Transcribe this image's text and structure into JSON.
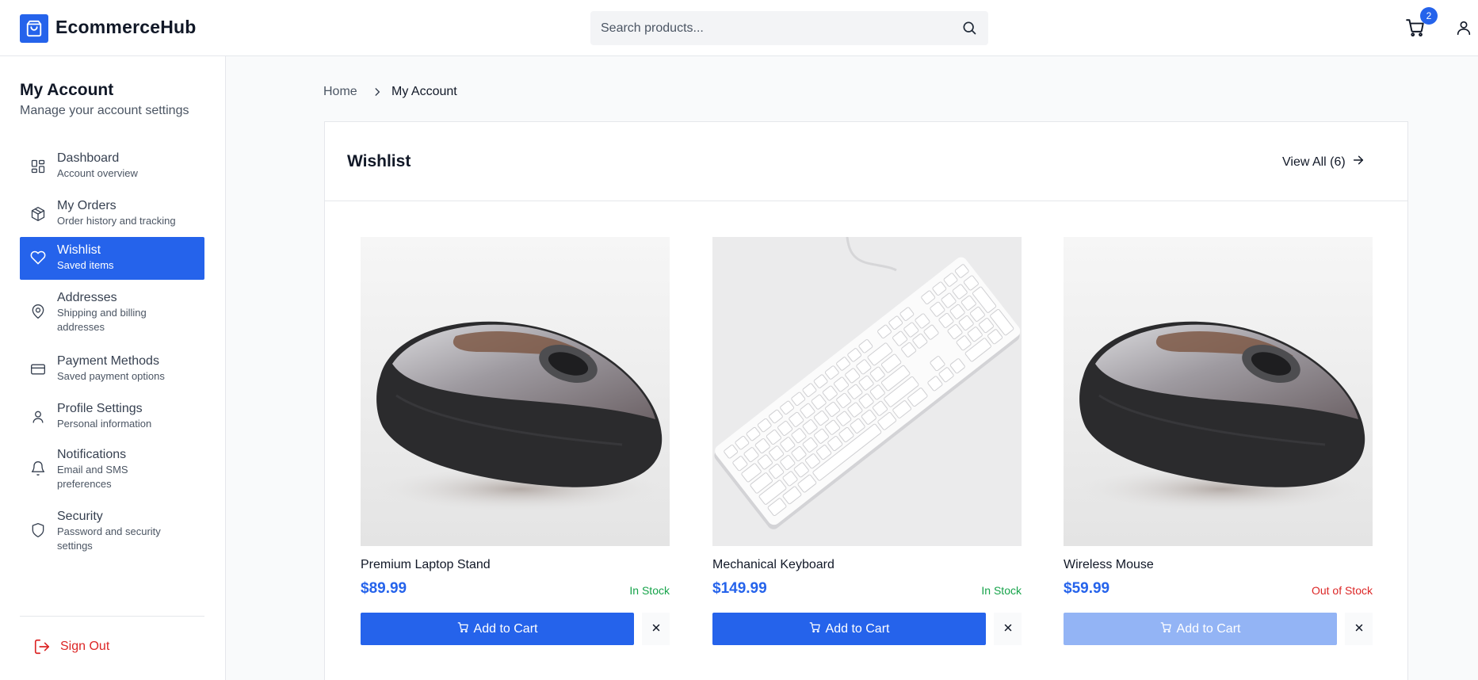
{
  "header": {
    "brand": "EcommerceHub",
    "search_placeholder": "Search products...",
    "cart_count": "2"
  },
  "sidebar": {
    "title": "My Account",
    "subtitle": "Manage your account settings",
    "items": [
      {
        "label": "Dashboard",
        "desc": "Account overview",
        "icon": "dashboard-icon"
      },
      {
        "label": "My Orders",
        "desc": "Order history and tracking",
        "icon": "package-icon"
      },
      {
        "label": "Wishlist",
        "desc": "Saved items",
        "icon": "heart-icon",
        "active": true
      },
      {
        "label": "Addresses",
        "desc": "Shipping and billing addresses",
        "icon": "map-pin-icon"
      },
      {
        "label": "Payment Methods",
        "desc": "Saved payment options",
        "icon": "credit-card-icon"
      },
      {
        "label": "Profile Settings",
        "desc": "Personal information",
        "icon": "user-icon"
      },
      {
        "label": "Notifications",
        "desc": "Email and SMS preferences",
        "icon": "bell-icon"
      },
      {
        "label": "Security",
        "desc": "Password and security settings",
        "icon": "shield-icon"
      }
    ],
    "signout_label": "Sign Out"
  },
  "breadcrumb": {
    "home": "Home",
    "current": "My Account"
  },
  "wishlist": {
    "title": "Wishlist",
    "view_all": "View All (6)",
    "products": [
      {
        "name": "Premium Laptop Stand",
        "price": "$89.99",
        "stock": "In Stock",
        "stock_color": "#16a34a",
        "cart_label": "Add to Cart",
        "image": "mouse"
      },
      {
        "name": "Mechanical Keyboard",
        "price": "$149.99",
        "stock": "In Stock",
        "stock_color": "#16a34a",
        "cart_label": "Add to Cart",
        "image": "keyboard"
      },
      {
        "name": "Wireless Mouse",
        "price": "$59.99",
        "stock": "Out of Stock",
        "stock_color": "#dc2626",
        "cart_label": "Add to Cart",
        "image": "mouse"
      }
    ]
  },
  "colors": {
    "accent": "#2563eb",
    "danger": "#dc2626",
    "success": "#16a34a"
  }
}
